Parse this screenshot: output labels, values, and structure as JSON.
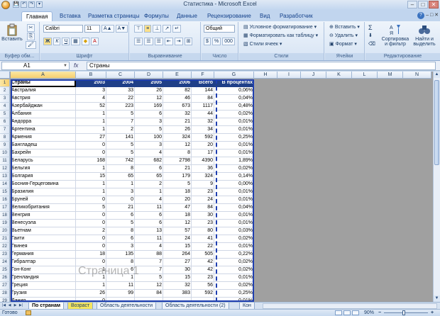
{
  "window": {
    "title": "Статистика - Microsoft Excel",
    "qat": [
      "💾",
      "↶",
      "↷",
      "▾"
    ],
    "controls": [
      "–",
      "□",
      "✕"
    ]
  },
  "tabs": [
    "Главная",
    "Вставка",
    "Разметка страницы",
    "Формулы",
    "Данные",
    "Рецензирование",
    "Вид",
    "Разработчик"
  ],
  "ribbon": {
    "clipboard": {
      "paste": "Вставить",
      "title": "Буфер обм..."
    },
    "font": {
      "name": "Calibri",
      "size": "11",
      "grow": "A▲",
      "shrink": "A▼",
      "bold": "Ж",
      "italic": "К",
      "underline": "Ч",
      "title": "Шрифт"
    },
    "alignment": {
      "title": "Выравнивание"
    },
    "number": {
      "format": "Общий",
      "percent": "%",
      "thousands": "000",
      "title": "Число"
    },
    "styles": {
      "conditional": "Условное форматирование",
      "table": "Форматировать как таблицу",
      "cellstyles": "Стили ячеек",
      "title": "Стили"
    },
    "cells": {
      "insert": "Вставить",
      "delete": "Удалить",
      "format": "Формат",
      "title": "Ячейки"
    },
    "editing": {
      "sigma": "Σ",
      "sort_l1": "Сортировка",
      "sort_l2": "и фильтр",
      "find_l1": "Найти и",
      "find_l2": "выделить",
      "title": "Редактирование"
    }
  },
  "formula_bar": {
    "name_box": "A1",
    "fx": "fx",
    "value": "Страны"
  },
  "columns": [
    "A",
    "B",
    "C",
    "D",
    "E",
    "F",
    "G",
    "H",
    "I",
    "J",
    "K",
    "L",
    "M",
    "N"
  ],
  "table": {
    "header": [
      "Страны",
      "2003",
      "2004",
      "2005",
      "2006",
      "Всего",
      "В процентах"
    ],
    "rows": [
      [
        "Австралия",
        "3",
        "33",
        "26",
        "82",
        "144",
        "0,06%"
      ],
      [
        "Австрия",
        "4",
        "22",
        "12",
        "46",
        "84",
        "0,04%"
      ],
      [
        "Азербайджан",
        "52",
        "223",
        "169",
        "673",
        "1117",
        "0,48%"
      ],
      [
        "Албания",
        "1",
        "5",
        "6",
        "32",
        "44",
        "0,02%"
      ],
      [
        "Андорра",
        "1",
        "7",
        "3",
        "21",
        "32",
        "0,01%"
      ],
      [
        "Аргентина",
        "1",
        "2",
        "5",
        "26",
        "34",
        "0,01%"
      ],
      [
        "Армения",
        "27",
        "141",
        "100",
        "324",
        "592",
        "0,25%"
      ],
      [
        "Бангладеш",
        "0",
        "5",
        "3",
        "12",
        "20",
        "0,01%"
      ],
      [
        "Бахрейн",
        "0",
        "5",
        "4",
        "8",
        "17",
        "0,01%"
      ],
      [
        "Беларусь",
        "168",
        "742",
        "682",
        "2798",
        "4390",
        "1,89%"
      ],
      [
        "Бельгия",
        "1",
        "8",
        "6",
        "21",
        "36",
        "0,02%"
      ],
      [
        "Болгария",
        "15",
        "65",
        "65",
        "179",
        "324",
        "0,14%"
      ],
      [
        "Босния-Герцеговина",
        "1",
        "1",
        "2",
        "5",
        "9",
        "0,00%"
      ],
      [
        "Бразилия",
        "1",
        "3",
        "1",
        "18",
        "23",
        "0,01%"
      ],
      [
        "Бруней",
        "0",
        "0",
        "4",
        "20",
        "24",
        "0,01%"
      ],
      [
        "Великобритания",
        "5",
        "21",
        "11",
        "47",
        "84",
        "0,04%"
      ],
      [
        "Венгрия",
        "0",
        "6",
        "6",
        "18",
        "30",
        "0,01%"
      ],
      [
        "Венесуэла",
        "0",
        "5",
        "6",
        "12",
        "23",
        "0,01%"
      ],
      [
        "Вьетнам",
        "2",
        "8",
        "13",
        "57",
        "80",
        "0,03%"
      ],
      [
        "Гаити",
        "0",
        "6",
        "11",
        "24",
        "41",
        "0,02%"
      ],
      [
        "Гвинея",
        "0",
        "3",
        "4",
        "15",
        "22",
        "0,01%"
      ],
      [
        "Германия",
        "18",
        "135",
        "88",
        "264",
        "505",
        "0,22%"
      ],
      [
        "Гибралтар",
        "0",
        "8",
        "7",
        "27",
        "42",
        "0,02%"
      ],
      [
        "Гон-Конг",
        "1",
        "6",
        "7",
        "30",
        "42",
        "0,02%"
      ],
      [
        "Гренландия",
        "1",
        "1",
        "5",
        "15",
        "23",
        "0,01%"
      ],
      [
        "Греция",
        "1",
        "11",
        "12",
        "32",
        "56",
        "0,02%"
      ],
      [
        "Грузия",
        "26",
        "99",
        "84",
        "383",
        "592",
        "0,25%"
      ],
      [
        "Дания",
        "0",
        "",
        "",
        "",
        "",
        "0,01%"
      ]
    ]
  },
  "watermark": "Страница 1",
  "sheets": [
    "По странам",
    "Возраст",
    "Область деятельности",
    "Область деятельности (2)",
    "Кон"
  ],
  "status": {
    "ready": "Готово",
    "zoom": "90%",
    "zoom_percent": 90
  }
}
